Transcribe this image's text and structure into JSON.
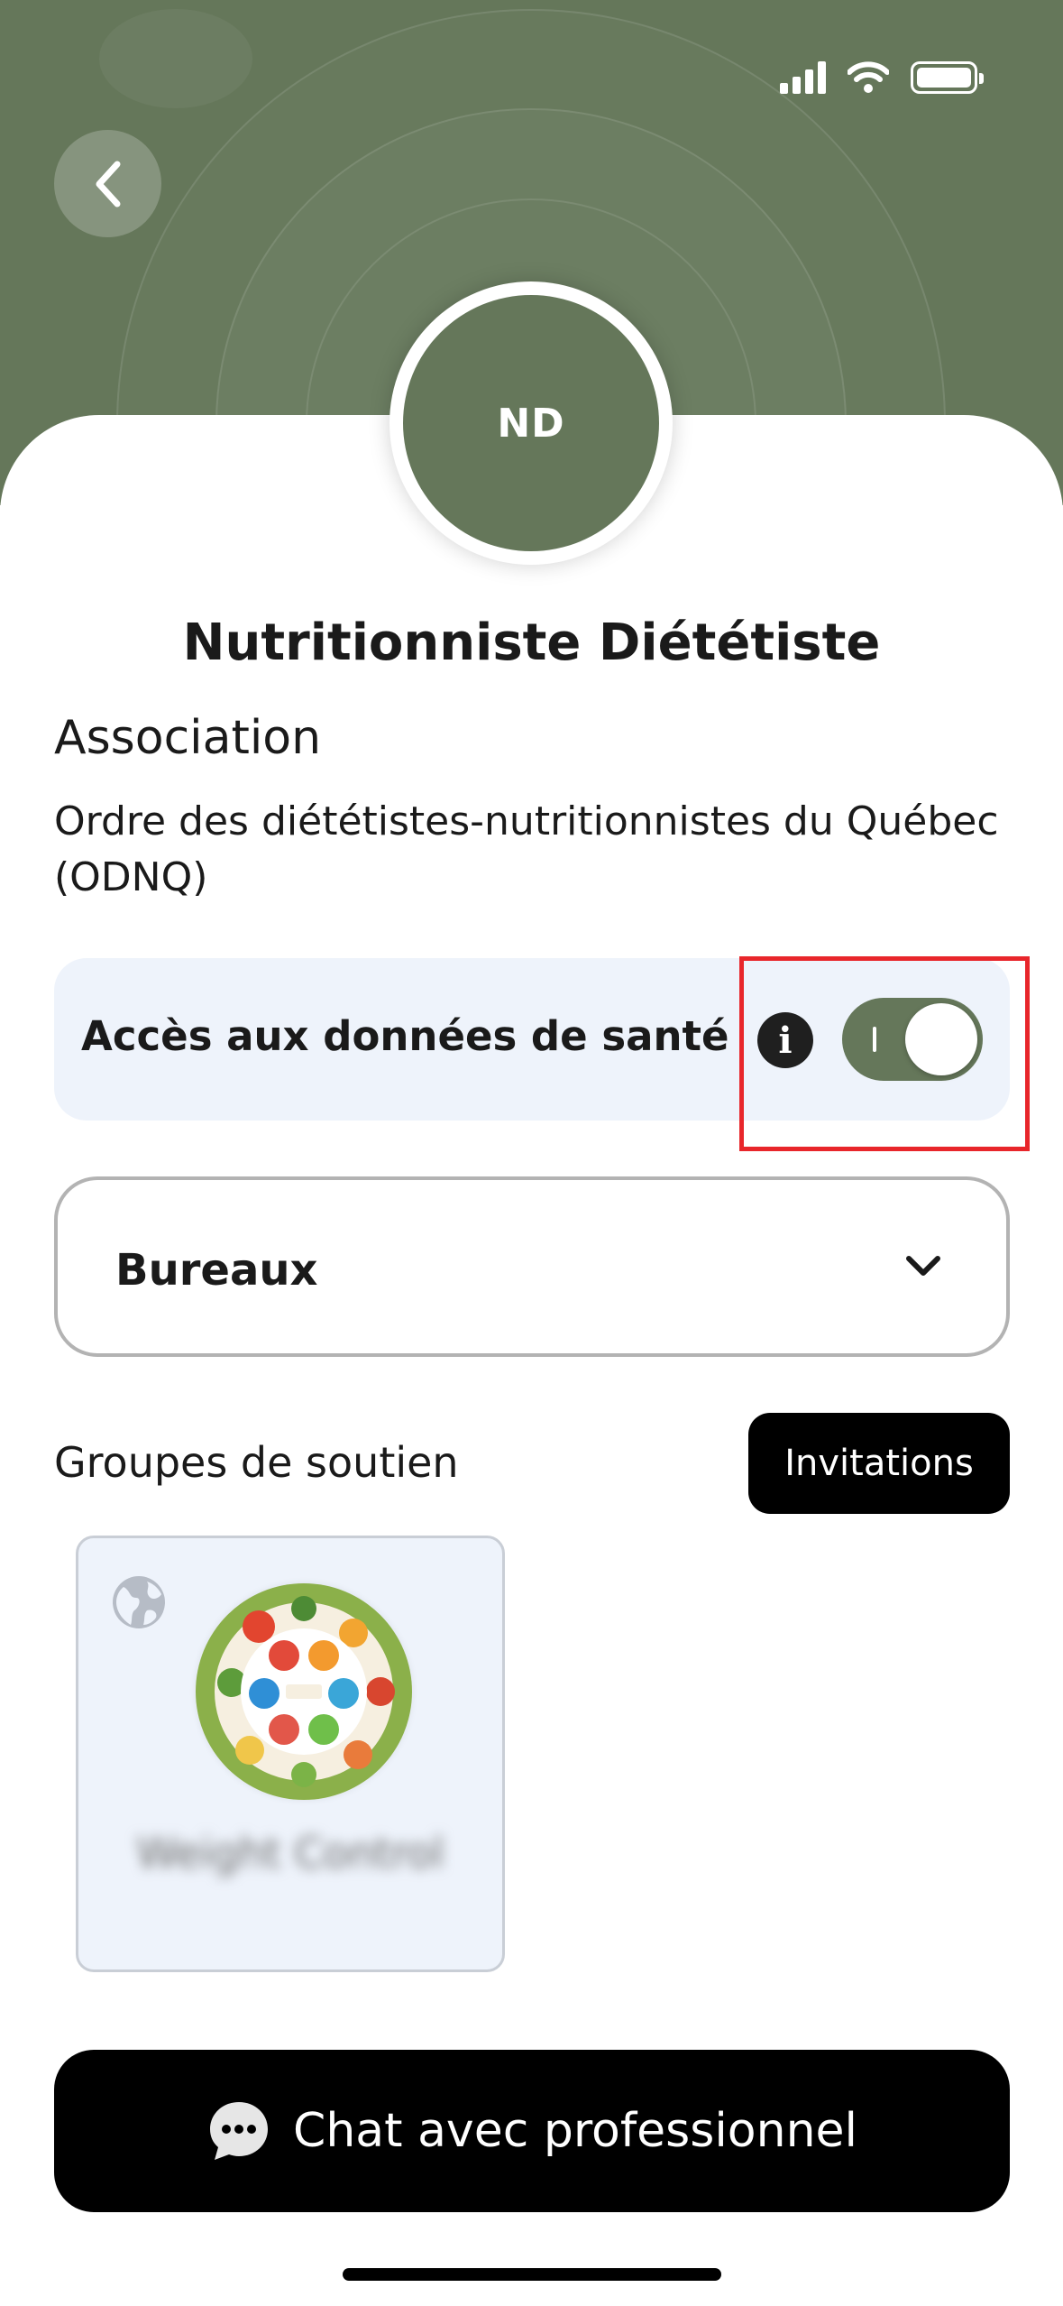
{
  "icons": {
    "back": "chevron-left-icon",
    "info": "info-icon",
    "dropdown": "chevron-down-icon",
    "globe": "globe-icon",
    "chat": "chat-bubble-icon"
  },
  "colors": {
    "accent": "#65775a",
    "highlight": "#e8262b",
    "panel": "#eef3fb"
  },
  "profile": {
    "initials": "ND",
    "title": "Nutritionniste Diététiste",
    "association_heading": "Association",
    "association_name": "Ordre des diététistes-nutritionnistes du Québec (ODNQ)"
  },
  "health_access": {
    "label": "Accès aux données de santé",
    "info_glyph": "i",
    "enabled": true
  },
  "offices": {
    "label": "Bureaux"
  },
  "support_groups": {
    "heading": "Groupes de soutien",
    "invitations_label": "Invitations",
    "items": [
      {
        "name": "Weight Control",
        "visibility": "public"
      }
    ]
  },
  "chat": {
    "label": "Chat avec professionnel"
  }
}
